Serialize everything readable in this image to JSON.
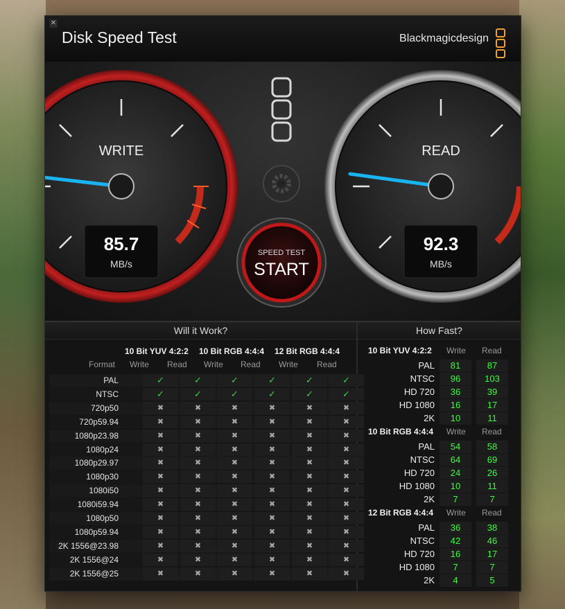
{
  "window": {
    "title": "Disk Speed Test",
    "brand": "Blackmagicdesign",
    "close_icon": "close-icon"
  },
  "write_gauge": {
    "label": "WRITE",
    "value": "85.7",
    "unit": "MB/s"
  },
  "read_gauge": {
    "label": "READ",
    "value": "92.3",
    "unit": "MB/s"
  },
  "start": {
    "caption": "SPEED TEST",
    "label": "START"
  },
  "will_it_work": {
    "title": "Will it Work?",
    "format_label": "Format",
    "groups": [
      "10 Bit YUV 4:2:2",
      "10 Bit RGB 4:4:4",
      "12 Bit RGB 4:4:4"
    ],
    "col_labels": [
      "Write",
      "Read"
    ],
    "rows": [
      {
        "format": "PAL",
        "ok": true
      },
      {
        "format": "NTSC",
        "ok": true
      },
      {
        "format": "720p50",
        "ok": false
      },
      {
        "format": "720p59.94",
        "ok": false
      },
      {
        "format": "1080p23.98",
        "ok": false
      },
      {
        "format": "1080p24",
        "ok": false
      },
      {
        "format": "1080p29.97",
        "ok": false
      },
      {
        "format": "1080p30",
        "ok": false
      },
      {
        "format": "1080i50",
        "ok": false
      },
      {
        "format": "1080i59.94",
        "ok": false
      },
      {
        "format": "1080p50",
        "ok": false
      },
      {
        "format": "1080p59.94",
        "ok": false
      },
      {
        "format": "2K 1556@23.98",
        "ok": false
      },
      {
        "format": "2K 1556@24",
        "ok": false
      },
      {
        "format": "2K 1556@25",
        "ok": false
      }
    ],
    "check_symbol": "✓",
    "cross_symbol": "✖"
  },
  "how_fast": {
    "title": "How Fast?",
    "col_labels": [
      "Write",
      "Read"
    ],
    "groups": [
      {
        "name": "10 Bit YUV 4:2:2",
        "rows": [
          {
            "format": "PAL",
            "write": "81",
            "read": "87"
          },
          {
            "format": "NTSC",
            "write": "96",
            "read": "103"
          },
          {
            "format": "HD 720",
            "write": "36",
            "read": "39"
          },
          {
            "format": "HD 1080",
            "write": "16",
            "read": "17"
          },
          {
            "format": "2K",
            "write": "10",
            "read": "11"
          }
        ]
      },
      {
        "name": "10 Bit RGB 4:4:4",
        "rows": [
          {
            "format": "PAL",
            "write": "54",
            "read": "58"
          },
          {
            "format": "NTSC",
            "write": "64",
            "read": "69"
          },
          {
            "format": "HD 720",
            "write": "24",
            "read": "26"
          },
          {
            "format": "HD 1080",
            "write": "10",
            "read": "11"
          },
          {
            "format": "2K",
            "write": "7",
            "read": "7"
          }
        ]
      },
      {
        "name": "12 Bit RGB 4:4:4",
        "rows": [
          {
            "format": "PAL",
            "write": "36",
            "read": "38"
          },
          {
            "format": "NTSC",
            "write": "42",
            "read": "46"
          },
          {
            "format": "HD 720",
            "write": "16",
            "read": "17"
          },
          {
            "format": "HD 1080",
            "write": "7",
            "read": "7"
          },
          {
            "format": "2K",
            "write": "4",
            "read": "5"
          }
        ]
      }
    ]
  },
  "colors": {
    "ok": "#39d24a",
    "value": "#3aff3a",
    "accent": "#f0a030",
    "needle": "#19b4f0",
    "write_ring": "#b41e1e"
  }
}
